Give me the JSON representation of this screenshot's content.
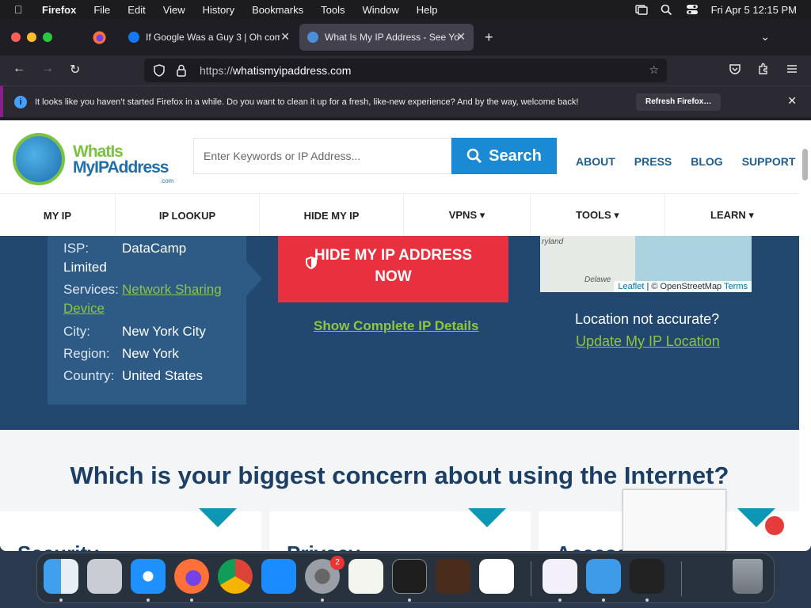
{
  "menubar": {
    "app": "Firefox",
    "items": [
      "File",
      "Edit",
      "View",
      "History",
      "Bookmarks",
      "Tools",
      "Window",
      "Help"
    ],
    "clock": "Fri Apr 5  12:15 PM"
  },
  "tabs": [
    {
      "title": "If Google Was a Guy 3 | Oh com",
      "favicon": "facebook-icon"
    },
    {
      "title": "What Is My IP Address - See You",
      "favicon": "globe-icon"
    }
  ],
  "urlbar": {
    "prefix": "https://",
    "host": "whatismyipaddress.com"
  },
  "notice": {
    "text": "It looks like you haven’t started Firefox in a while. Do you want to clean it up for a fresh, like-new experience? And by the way, welcome back!",
    "button": "Refresh Firefox…"
  },
  "site": {
    "logo": {
      "line1": "WhatIs",
      "line2": "MyIPAddress",
      "line3": ".com"
    },
    "search_placeholder": "Enter Keywords or IP Address...",
    "search_button": "Search",
    "toplinks": [
      "ABOUT",
      "PRESS",
      "BLOG",
      "SUPPORT"
    ],
    "nav": [
      "MY IP",
      "IP LOOKUP",
      "HIDE MY IP",
      "VPNS ▾",
      "TOOLS ▾",
      "LEARN ▾"
    ],
    "info": {
      "isp_label": "ISP:",
      "isp_value": "DataCamp",
      "isp_cont": "Limited",
      "services_label": "Services:",
      "services_value": "Network Sharing",
      "services_cont": "Device",
      "city_label": "City:",
      "city_value": "New York City",
      "region_label": "Region:",
      "region_value": "New York",
      "country_label": "Country:",
      "country_value": "United States"
    },
    "hide_button": {
      "line1": "HIDE MY IP ADDRESS",
      "line2": "NOW"
    },
    "show_details": "Show Complete IP Details",
    "map": {
      "label1": "ryland",
      "label2": "Delawe",
      "attr_leaflet": "Leaflet",
      "attr_osm": " | © OpenStreetMap ",
      "attr_terms": "Terms"
    },
    "location_q": "Location not accurate?",
    "location_link": "Update My IP Location",
    "concern_title": "Which is your biggest concern about using the Internet?",
    "cards": [
      "Security",
      "Privacy",
      "Access"
    ]
  },
  "dock": {
    "apps": [
      "finder-icon",
      "launchpad-icon",
      "safari-icon",
      "firefox-icon",
      "chrome-icon",
      "app-store-icon",
      "system-settings-icon",
      "textedit-icon",
      "terminal-icon",
      "garageband-icon",
      "vscode-icon",
      "visual-studio-icon",
      "weather-icon",
      "activity-monitor-icon",
      "trash-icon"
    ],
    "badge": "2"
  },
  "colors": {
    "accent": "#1a8ad4",
    "hero": "#234870",
    "cta": "#e8303f",
    "link": "#8dc63f"
  }
}
